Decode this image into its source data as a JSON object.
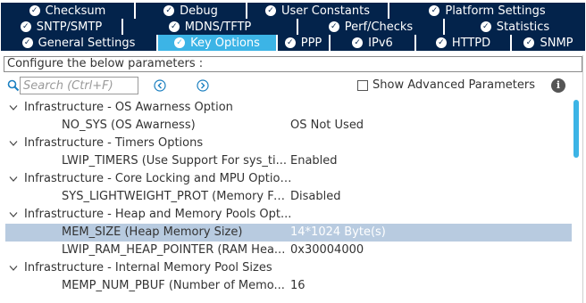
{
  "tabs": {
    "row1": [
      {
        "label": "Checksum"
      },
      {
        "label": "Debug"
      },
      {
        "label": "User Constants"
      },
      {
        "label": "Platform Settings"
      }
    ],
    "row2": [
      {
        "label": "SNTP/SMTP"
      },
      {
        "label": "MDNS/TFTP"
      },
      {
        "label": "Perf/Checks"
      },
      {
        "label": "Statistics"
      }
    ],
    "row3": [
      {
        "label": "General Settings"
      },
      {
        "label": "Key Options",
        "active": true
      },
      {
        "label": "PPP"
      },
      {
        "label": "IPv6"
      },
      {
        "label": "HTTPD"
      },
      {
        "label": "SNMP"
      }
    ]
  },
  "description": "Configure the below parameters :",
  "search": {
    "placeholder": "Search (Ctrl+F)"
  },
  "advanced": {
    "label": "Show Advanced Parameters",
    "checked": false
  },
  "tree": [
    {
      "type": "category",
      "label": "Infrastructure - OS Awarness Option"
    },
    {
      "type": "param",
      "name": "NO_SYS (OS Awarness)",
      "value": "OS Not Used"
    },
    {
      "type": "category",
      "label": "Infrastructure - Timers Options"
    },
    {
      "type": "param",
      "name": "LWIP_TIMERS (Use Support For sys_ti...",
      "value": "Enabled"
    },
    {
      "type": "category",
      "label": "Infrastructure - Core Locking and MPU Options"
    },
    {
      "type": "param",
      "name": "SYS_LIGHTWEIGHT_PROT (Memory Fu...",
      "value": "Disabled"
    },
    {
      "type": "category",
      "label": "Infrastructure - Heap and Memory Pools Opt..."
    },
    {
      "type": "param",
      "name": "MEM_SIZE (Heap Memory Size)",
      "value": "14*1024 Byte(s)",
      "selected": true
    },
    {
      "type": "param",
      "name": "LWIP_RAM_HEAP_POINTER (RAM Hea...",
      "value": "0x30004000"
    },
    {
      "type": "category",
      "label": "Infrastructure - Internal Memory Pool Sizes"
    },
    {
      "type": "param",
      "name": "MEMP_NUM_PBUF (Number of Memo...",
      "value": "16"
    }
  ],
  "colors": {
    "tab_bg": "#03234b",
    "tab_active": "#3cb4e6",
    "selected_row": "#b8cbe0"
  }
}
